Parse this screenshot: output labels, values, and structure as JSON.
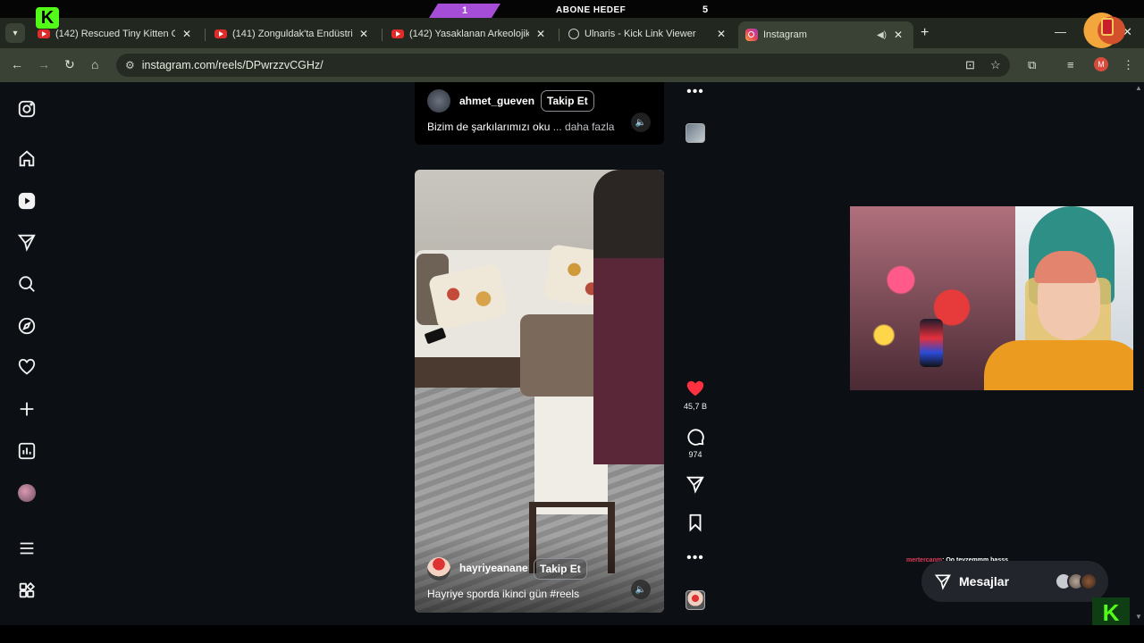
{
  "stream_overlay": {
    "sub_count": "1",
    "goal_label": "ABONE HEDEF",
    "goal_target": "5",
    "kick_logo": "K"
  },
  "tabs": [
    {
      "label": "(142) Rescued Tiny Kitten Grow",
      "icon": "youtube-icon"
    },
    {
      "label": "(141) Zonguldak'ta Endüstriyel",
      "icon": "youtube-icon"
    },
    {
      "label": "(142) Yasaklanan Arkeolojik Ge",
      "icon": "youtube-icon"
    },
    {
      "label": "Ulnaris - Kick Link Viewer",
      "icon": "link-icon"
    },
    {
      "label": "Instagram",
      "icon": "instagram-icon",
      "active": true
    }
  ],
  "address_bar": {
    "url": "instagram.com/reels/DPwrzzvCGHz/"
  },
  "profile_initial": "M",
  "previous_reel": {
    "username": "ahmet_gueven",
    "follow_label": "Takip Et",
    "caption": "Bizim de şarkılarımızı oku",
    "more_label": "... daha fazla"
  },
  "current_reel": {
    "username": "hayriyeanane",
    "follow_label": "Takip Et",
    "caption": "Hayriye sporda ikinci gün #reels",
    "likes": "45,7 B",
    "comments": "974"
  },
  "chat": {
    "username": "mertercanm",
    "message": ": Oo teyzemmm basss"
  },
  "messages_label": "Mesajlar",
  "colors": {
    "like_red": "#ff3040",
    "kick_green": "#53fc18",
    "chrome_bg": "#22281f",
    "page_bg": "#0c0f13"
  }
}
